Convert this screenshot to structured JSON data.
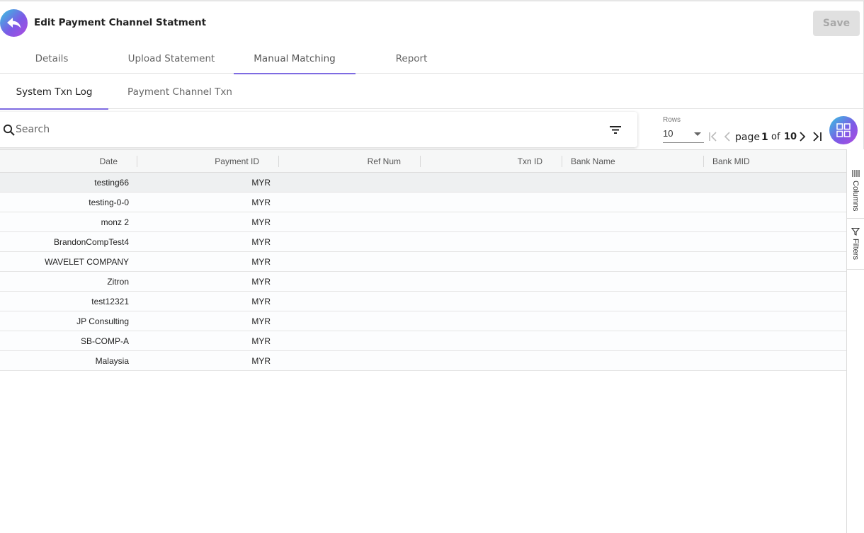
{
  "header": {
    "title": "Edit Payment Channel Statment",
    "save_label": "Save"
  },
  "main_tabs": [
    {
      "label": "Details"
    },
    {
      "label": "Upload Statement"
    },
    {
      "label": "Manual Matching",
      "active": true
    },
    {
      "label": "Report"
    }
  ],
  "sub_tabs": [
    {
      "label": "System Txn Log",
      "active": true
    },
    {
      "label": "Payment Channel Txn"
    }
  ],
  "search": {
    "placeholder": "Search",
    "value": ""
  },
  "pagination": {
    "rows_label": "Rows",
    "rows_value": "10",
    "page_word": "page",
    "current_page": "1",
    "of_word": "of",
    "total_pages": "10"
  },
  "grid": {
    "columns": [
      "Date",
      "Payment ID",
      "Ref Num",
      "Txn ID",
      "Bank Name",
      "Bank MID"
    ],
    "rows": [
      [
        "testing66",
        "MYR",
        "",
        "",
        "",
        ""
      ],
      [
        "testing-0-0",
        "MYR",
        "",
        "",
        "",
        ""
      ],
      [
        "monz 2",
        "MYR",
        "",
        "",
        "",
        ""
      ],
      [
        "BrandonCompTest4",
        "MYR",
        "",
        "",
        "",
        ""
      ],
      [
        "WAVELET COMPANY",
        "MYR",
        "",
        "",
        "",
        ""
      ],
      [
        "Zitron",
        "MYR",
        "",
        "",
        "",
        ""
      ],
      [
        "test12321",
        "MYR",
        "",
        "",
        "",
        ""
      ],
      [
        "JP Consulting",
        "MYR",
        "",
        "",
        "",
        ""
      ],
      [
        "SB-COMP-A",
        "MYR",
        "",
        "",
        "",
        ""
      ],
      [
        "Malaysia",
        "MYR",
        "",
        "",
        "",
        ""
      ]
    ]
  },
  "side_panel": {
    "columns_label": "Columns",
    "filters_label": "Filters"
  },
  "colors": {
    "accent": "#7e6be2",
    "gradient_start": "#35c6e0",
    "gradient_end": "#b04be0"
  },
  "icons": [
    "back-arrow-icon",
    "search-icon",
    "filter-icon",
    "first-page-icon",
    "prev-page-icon",
    "next-page-icon",
    "last-page-icon",
    "grid-view-icon",
    "columns-icon",
    "filters-icon"
  ]
}
